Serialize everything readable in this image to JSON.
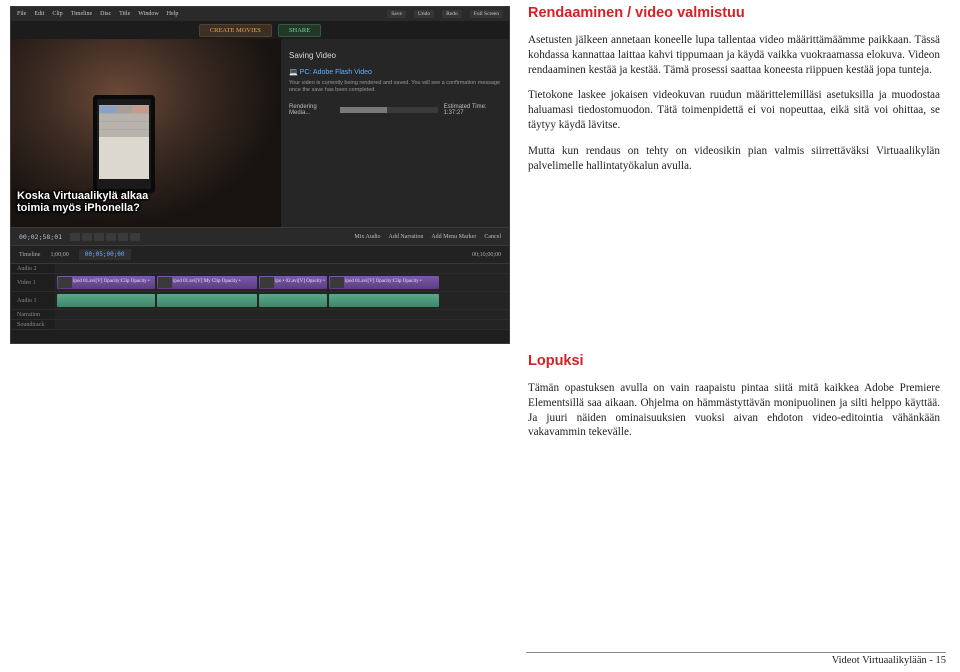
{
  "article": {
    "section1": {
      "heading": "Rendaaminen / video valmistuu",
      "p1": "Asetusten jälkeen annetaan koneelle lupa tallentaa video määrittämäämme paikkaan. Tässä kohdassa kannattaa laittaa kahvi tippumaan ja käydä vaikka vuokraamassa elokuva. Videon rendaaminen kestää ja kestää. Tämä prosessi saattaa koneesta riippuen kestää jopa tunteja.",
      "p2": "Tietokone laskee jokaisen videokuvan ruudun määrittelemilläsi asetuksilla ja muodostaa haluamasi tiedostomuodon. Tätä toimenpidettä ei voi nopeuttaa, eikä sitä voi ohittaa, se täytyy käydä lävitse.",
      "p3": "Mutta kun rendaus on tehty on videosikin pian valmis siirrettäväksi Virtuaalikylän palvelimelle hallintatyökalun avulla."
    },
    "section2": {
      "heading": "Lopuksi",
      "p1": "Tämän opastuksen avulla on vain raapaistu pintaa siitä mitä kaikkea Adobe Premiere Elementsillä saa aikaan. Ohjelma on hämmästyttävän monipuolinen ja silti helppo käyttää. Ja juuri näiden ominaisuuksien vuoksi aivan ehdoton video-editointia vähänkään vakavammin tekevälle."
    }
  },
  "screenshot": {
    "menu": {
      "file": "File",
      "edit": "Edit",
      "clip": "Clip",
      "timeline": "Timeline",
      "disc": "Disc",
      "title": "Title",
      "window": "Window",
      "help": "Help"
    },
    "toolbar": {
      "save": "Save",
      "undo": "Undo",
      "redo": "Redo",
      "full": "Full Screen"
    },
    "orange_btn": "CREATE MOVIES",
    "green_btn": "SHARE",
    "dialog": {
      "title": "Saving Video",
      "tag": "PC: Adobe Flash Video",
      "note": "Your video is currently being rendered and saved. You will see a confirmation message once the save has been completed.",
      "rendering": "Rendering Media...",
      "eta": "Estimated Time: 1:37:27"
    },
    "overlay": {
      "line1": "Koska Virtuaalikylä alkaa",
      "line2": "toimia myös iPhonella?"
    },
    "transport": {
      "tc": "00;02;58;01",
      "opt1": "Mix Audio",
      "opt2": "Add Narration",
      "opt3": "Add Menu Marker",
      "cancel": "Cancel"
    },
    "timeline_head": {
      "label": "Timeline",
      "h1": "1;00;00",
      "tc": "00;05;00;00",
      "h2": "00;10;00;00"
    },
    "tracks": {
      "audio2": "Audio 2",
      "video1": "Video 1",
      "audio1": "Audio 1",
      "narration": "Narration",
      "soundtrack": "Soundtrack"
    },
    "clips": {
      "c1": "ipod 01.avi[V] Opacity:Clip Opacity •",
      "c2": "ipod 01.avi[V] My Clip Opacity •",
      "c3": "ipo • 02.avi[V] Opacity •",
      "c4": "ipod 01.avi[V] Opacity:Clip Opacity •"
    },
    "savebar": "Save"
  },
  "footer": {
    "label": "Videot Virtuaalikylään - ",
    "page": "15"
  }
}
